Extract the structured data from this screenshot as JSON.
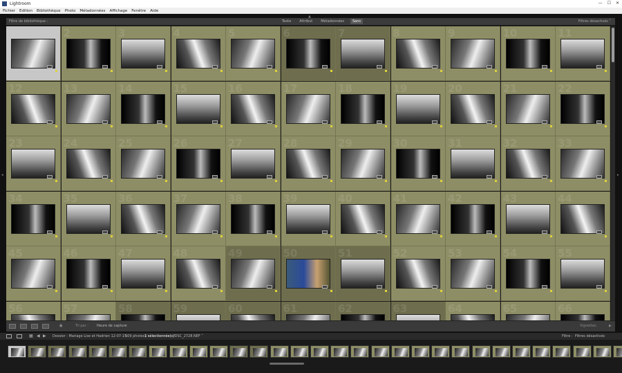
{
  "window": {
    "title": "Lightroom",
    "minimize": "—",
    "maximize": "☐",
    "close": "✕"
  },
  "menu": [
    "Fichier",
    "Edition",
    "Bibliothèque",
    "Photo",
    "Métadonnées",
    "Affichage",
    "Fenêtre",
    "Aide"
  ],
  "filter_bar": {
    "label": "Filtre de bibliothèque :",
    "tabs": [
      "Texte",
      "Attribut",
      "Métadonnées",
      "Sans"
    ],
    "active_tab": "Sans",
    "right_label": "Filtres désactivés ˅"
  },
  "grid": {
    "cell_numbers": [
      "",
      "2",
      "3",
      "4",
      "5",
      "6",
      "7",
      "8",
      "9",
      "10",
      "11",
      "12",
      "13",
      "14",
      "15",
      "16",
      "17",
      "18",
      "19",
      "20",
      "21",
      "22",
      "23",
      "24",
      "25",
      "26",
      "27",
      "28",
      "29",
      "30",
      "31",
      "32",
      "33",
      "34",
      "35",
      "36",
      "37",
      "38",
      "39",
      "40",
      "41",
      "42",
      "43",
      "44",
      "45",
      "46",
      "47",
      "48",
      "49",
      "50",
      "51",
      "52",
      "53",
      "54",
      "55",
      "56",
      "57",
      "58",
      "59",
      "60",
      "61",
      "62",
      "63",
      "64",
      "65",
      "66"
    ],
    "selected_index": 0,
    "dark_indices": [
      5,
      6,
      48,
      49,
      50,
      57,
      58,
      59,
      60,
      61,
      62
    ],
    "color_indices": [
      49
    ]
  },
  "toolbar": {
    "sort_label": "Tri par :",
    "sort_value": "Heure de capture",
    "thumb_label": "Vignettes"
  },
  "filmstrip_header": {
    "page1": "1",
    "page2": "2",
    "folder_label": "Dossier : Mariage Lise et Hadrien 12-07-15",
    "photo_count": "509 photos /",
    "selected_count": "1 sélectionnée(s)",
    "filename": "/DSC_2728.NEF ˅",
    "filter_label": "Filtre :",
    "filter_value": "Filtres désactivés"
  },
  "filmstrip": {
    "thumb_count": 31,
    "selected_index": 0,
    "dark_indices": [
      1,
      2,
      3,
      4,
      5,
      6,
      11,
      12
    ]
  },
  "icons": {
    "collapse": "▲",
    "left_panel": "◂",
    "right_panel": "▸",
    "prev": "◀",
    "next": "▶",
    "grid_view": "▦",
    "spray_can": "♠"
  }
}
